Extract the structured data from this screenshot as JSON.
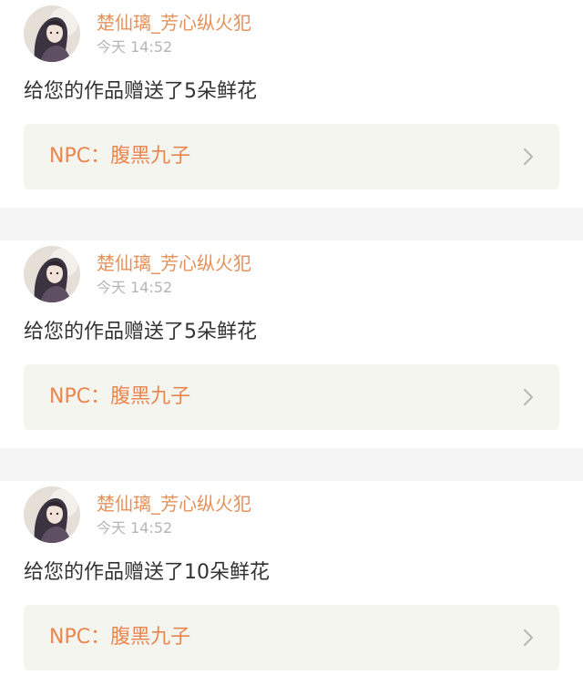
{
  "notifications": [
    {
      "username": "楚仙璃_芳心纵火犯",
      "time": "今天 14:52",
      "message": "给您的作品赠送了5朵鲜花",
      "work": "NPC：腹黑九子",
      "avatar_icon": "user-avatar",
      "chevron_icon": "chevron-right-icon"
    },
    {
      "username": "楚仙璃_芳心纵火犯",
      "time": "今天 14:52",
      "message": "给您的作品赠送了5朵鲜花",
      "work": "NPC：腹黑九子",
      "avatar_icon": "user-avatar",
      "chevron_icon": "chevron-right-icon"
    },
    {
      "username": "楚仙璃_芳心纵火犯",
      "time": "今天 14:52",
      "message": "给您的作品赠送了10朵鲜花",
      "work": "NPC：腹黑九子",
      "avatar_icon": "user-avatar",
      "chevron_icon": "chevron-right-icon"
    }
  ],
  "colors": {
    "username": "#e5915b",
    "link_text": "#e8864f",
    "link_bg": "#f5f5f0",
    "divider": "#f5f5f5",
    "message": "#333333",
    "time": "#b5b5b5"
  }
}
